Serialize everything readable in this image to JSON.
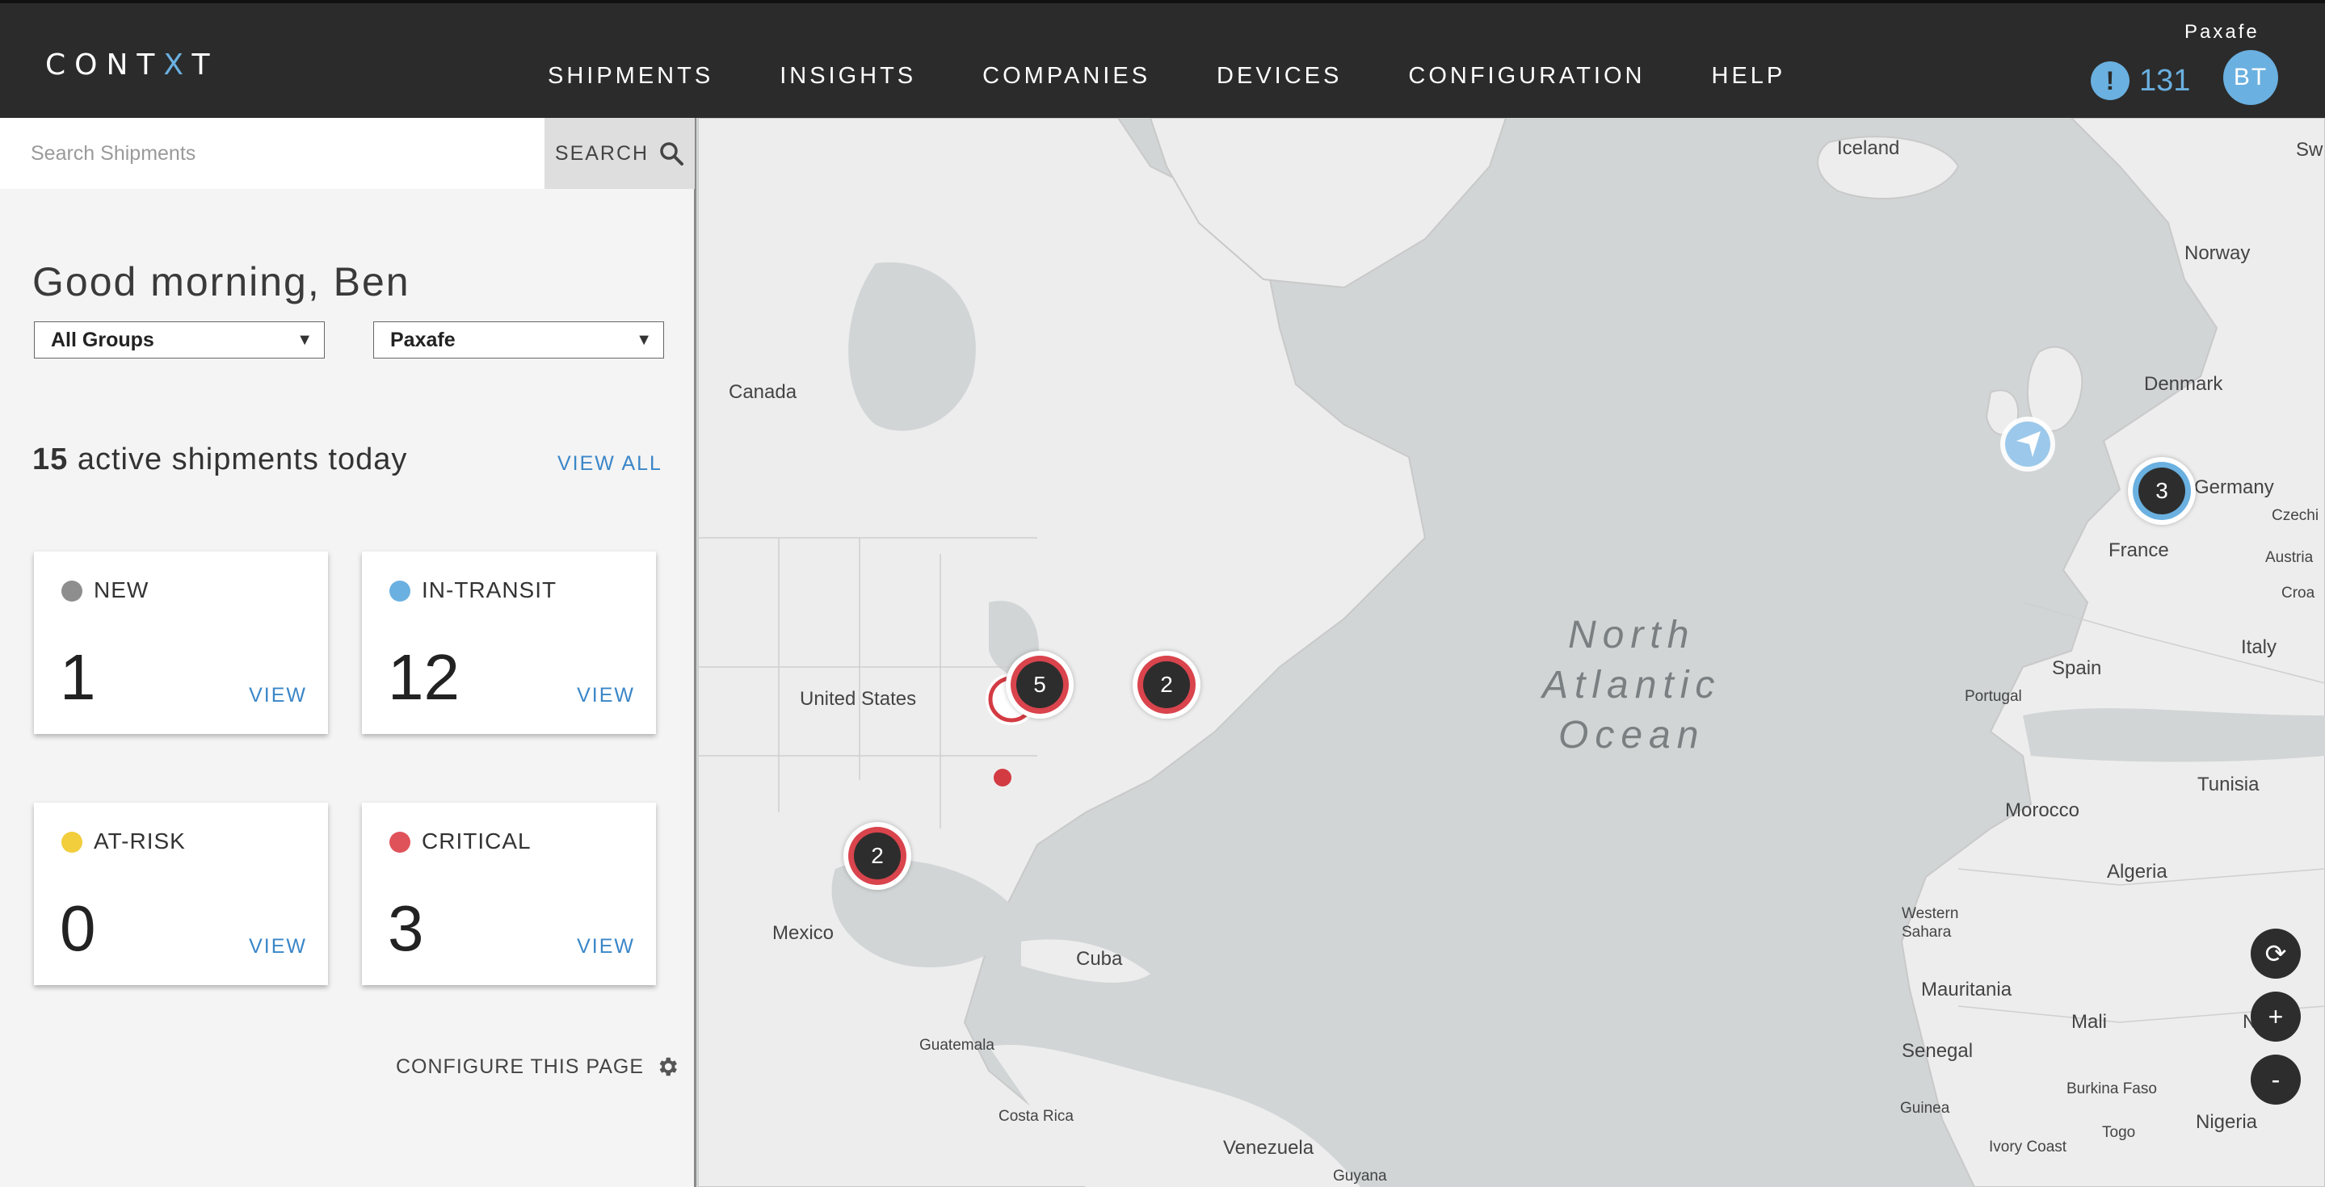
{
  "header": {
    "logo_prefix": "CONT",
    "logo_x": "X",
    "logo_suffix": "T",
    "nav": [
      "SHIPMENTS",
      "INSIGHTS",
      "COMPANIES",
      "DEVICES",
      "CONFIGURATION",
      "HELP"
    ],
    "user_name": "Paxafe",
    "alert_symbol": "!",
    "alert_count": "131",
    "avatar_initials": "BT"
  },
  "sidebar": {
    "search_placeholder": "Search Shipments",
    "search_button": "SEARCH",
    "greeting": "Good morning, Ben",
    "group_select": "All Groups",
    "company_select": "Paxafe",
    "active_count": "15",
    "active_text": "active shipments today",
    "view_all": "VIEW ALL",
    "cards": [
      {
        "label": "NEW",
        "count": "1",
        "view": "VIEW",
        "color": "#8e8e8e"
      },
      {
        "label": "IN-TRANSIT",
        "count": "12",
        "view": "VIEW",
        "color": "#6ab0e0"
      },
      {
        "label": "AT-RISK",
        "count": "0",
        "view": "VIEW",
        "color": "#f2cd3c"
      },
      {
        "label": "CRITICAL",
        "count": "3",
        "view": "VIEW",
        "color": "#e0525a"
      }
    ],
    "configure": "CONFIGURE THIS PAGE"
  },
  "map": {
    "places": {
      "iceland": "Iceland",
      "norway": "Norway",
      "denmark": "Denmark",
      "canada": "Canada",
      "germany": "Germany",
      "czechia": "Czechi",
      "france": "France",
      "austria": "Austria",
      "croatia": "Croa",
      "italy": "Italy",
      "spain": "Spain",
      "portugal": "Portugal",
      "united_states": "United States",
      "tunisia": "Tunisia",
      "morocco": "Morocco",
      "algeria": "Algeria",
      "western_sahara": "Western\nSahara",
      "mexico": "Mexico",
      "cuba": "Cuba",
      "mauritania": "Mauritania",
      "mali": "Mali",
      "niger": "Niger",
      "senegal": "Senegal",
      "guatemala": "Guatemala",
      "burkina_faso": "Burkina Faso",
      "guinea": "Guinea",
      "nigeria": "Nigeria",
      "costa_rica": "Costa Rica",
      "togo": "Togo",
      "ivory_coast": "Ivory Coast",
      "venezuela": "Venezuela",
      "guyana": "Guyana",
      "sweden": "Sw"
    },
    "ocean": "North\nAtlantic\nOcean",
    "clusters": [
      {
        "count": "5",
        "ring": "#d9444d"
      },
      {
        "count": "2",
        "ring": "#d9444d"
      },
      {
        "count": "2",
        "ring": "#d9444d"
      },
      {
        "count": "3",
        "ring": "#6ab0e0"
      }
    ],
    "controls": {
      "refresh": "⟳",
      "zoom_in": "+",
      "zoom_out": "-"
    }
  }
}
